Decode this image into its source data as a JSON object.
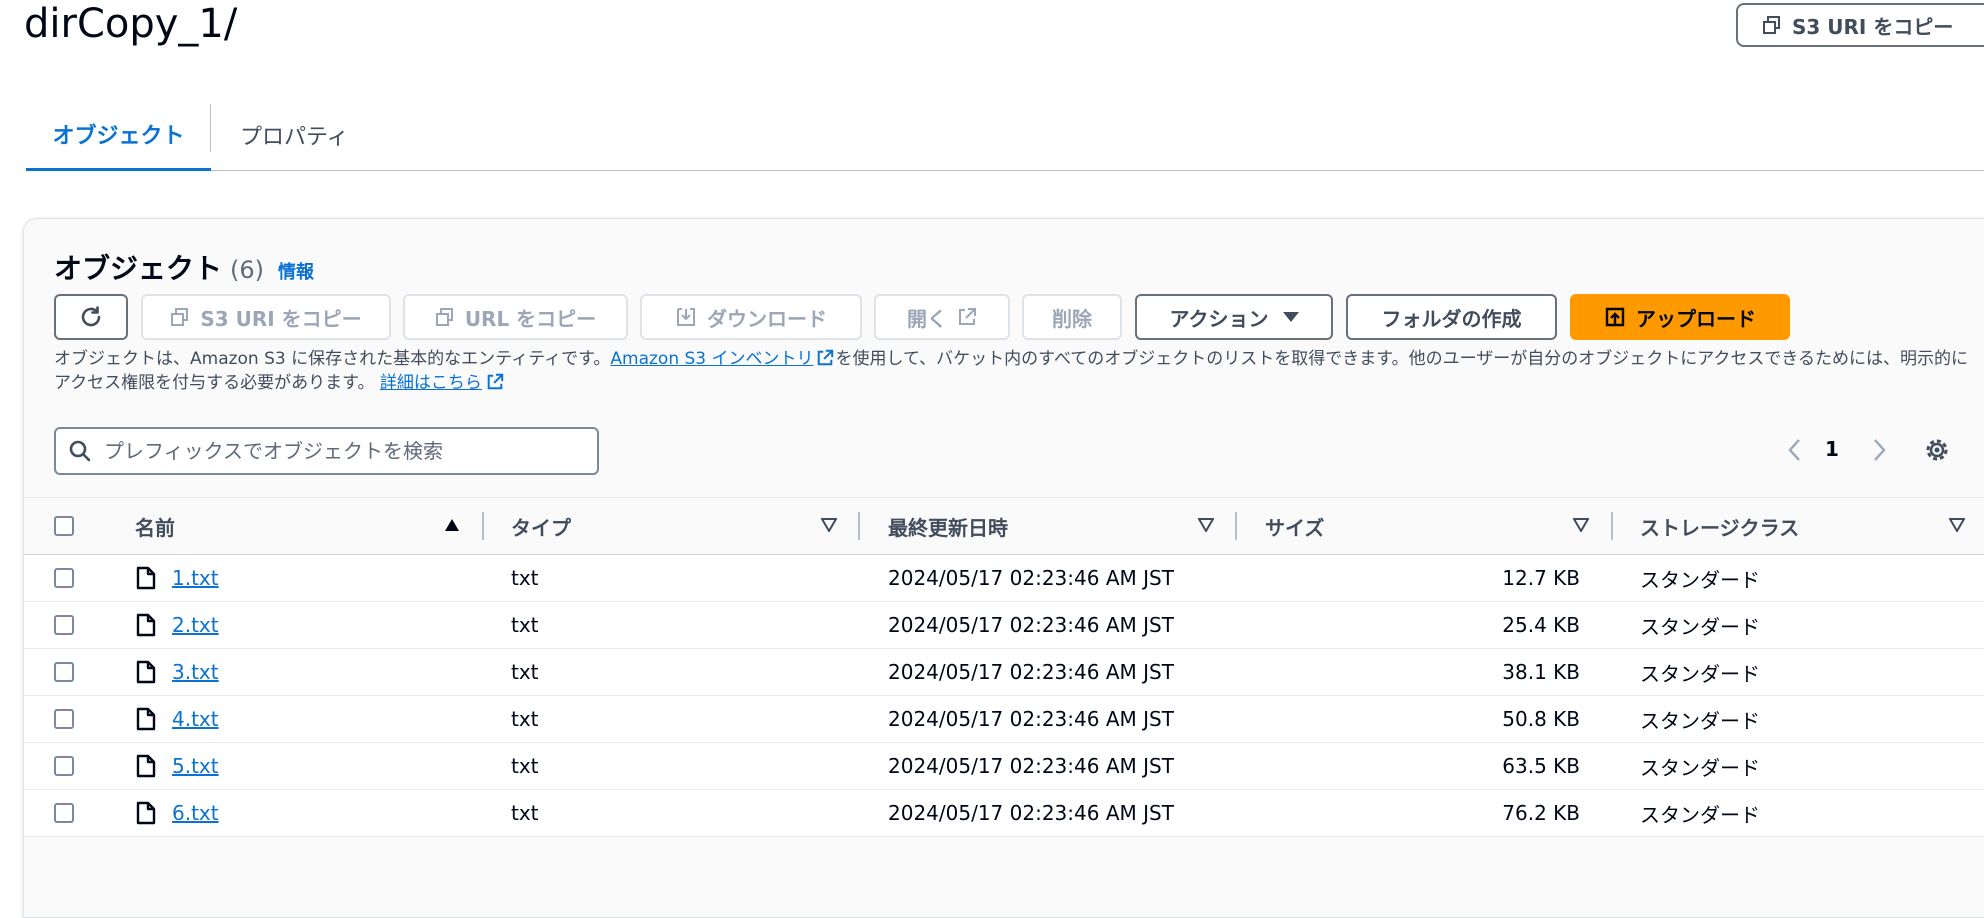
{
  "header": {
    "title": "dirCopy_1/",
    "copy_uri_label": "S3 URI をコピー"
  },
  "tabs": [
    {
      "label": "オブジェクト",
      "active": true
    },
    {
      "label": "プロパティ",
      "active": false
    }
  ],
  "objects": {
    "title": "オブジェクト",
    "count": "(6)",
    "info_label": "情報",
    "toolbar": {
      "refresh_icon": "refresh-icon",
      "copy_s3_uri": "S3 URI をコピー",
      "copy_url": "URL をコピー",
      "download": "ダウンロード",
      "open": "開く",
      "delete": "削除",
      "actions": "アクション",
      "create_folder": "フォルダの作成",
      "upload": "アップロード"
    },
    "description": {
      "part1": "オブジェクトは、Amazon S3 に保存された基本的なエンティティです。",
      "inventory_link": "Amazon S3 インベントリ",
      "part2": "を使用して、バケット内のすべてのオブジェクトのリストを取得できます。他のユーザーが自分のオブジェクトにアクセスできるためには、明示的にアクセス権限を付与する必要があります。",
      "details_link": "詳細はこちら"
    },
    "search": {
      "placeholder": "プレフィックスでオブジェクトを検索",
      "value": ""
    },
    "pagination": {
      "current_page": "1"
    },
    "columns": [
      "名前",
      "タイプ",
      "最終更新日時",
      "サイズ",
      "ストレージクラス"
    ],
    "rows": [
      {
        "name": "1.txt",
        "type": "txt",
        "modified": "2024/05/17 02:23:46 AM JST",
        "size": "12.7 KB",
        "storage": "スタンダード"
      },
      {
        "name": "2.txt",
        "type": "txt",
        "modified": "2024/05/17 02:23:46 AM JST",
        "size": "25.4 KB",
        "storage": "スタンダード"
      },
      {
        "name": "3.txt",
        "type": "txt",
        "modified": "2024/05/17 02:23:46 AM JST",
        "size": "38.1 KB",
        "storage": "スタンダード"
      },
      {
        "name": "4.txt",
        "type": "txt",
        "modified": "2024/05/17 02:23:46 AM JST",
        "size": "50.8 KB",
        "storage": "スタンダード"
      },
      {
        "name": "5.txt",
        "type": "txt",
        "modified": "2024/05/17 02:23:46 AM JST",
        "size": "63.5 KB",
        "storage": "スタンダード"
      },
      {
        "name": "6.txt",
        "type": "txt",
        "modified": "2024/05/17 02:23:46 AM JST",
        "size": "76.2 KB",
        "storage": "スタンダード"
      }
    ]
  },
  "colors": {
    "link": "#0972d3",
    "primary_button": "#ff9900",
    "text": "#000716",
    "muted": "#414d5c"
  }
}
